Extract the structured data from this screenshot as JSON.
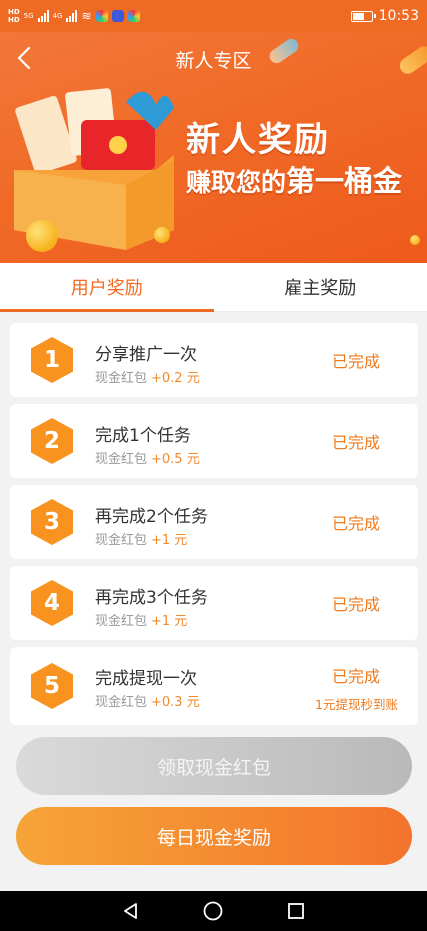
{
  "status_bar": {
    "network_top": "HD",
    "network_bottom": "HD",
    "sig1": "5G",
    "sig2": "4G",
    "time": "10:53"
  },
  "header": {
    "title": "新人专区",
    "back_icon": "chevron-left-icon"
  },
  "banner": {
    "line1": "新人奖励",
    "line2_prefix": "赚取您的",
    "line2_emphasis": "第一桶金"
  },
  "tabs": [
    {
      "label": "用户奖励",
      "active": true
    },
    {
      "label": "雇主奖励",
      "active": false
    }
  ],
  "tasks": [
    {
      "number": "1",
      "title": "分享推广一次",
      "reward_label": "现金红包",
      "reward_amount": "+0.2 元",
      "status": "已完成",
      "note": ""
    },
    {
      "number": "2",
      "title": "完成1个任务",
      "reward_label": "现金红包",
      "reward_amount": "+0.5 元",
      "status": "已完成",
      "note": ""
    },
    {
      "number": "3",
      "title": "再完成2个任务",
      "reward_label": "现金红包",
      "reward_amount": "+1 元",
      "status": "已完成",
      "note": ""
    },
    {
      "number": "4",
      "title": "再完成3个任务",
      "reward_label": "现金红包",
      "reward_amount": "+1 元",
      "status": "已完成",
      "note": ""
    },
    {
      "number": "5",
      "title": "完成提现一次",
      "reward_label": "现金红包",
      "reward_amount": "+0.3 元",
      "status": "已完成",
      "note": "1元提现秒到账"
    }
  ],
  "buttons": {
    "claim": "领取现金红包",
    "daily": "每日现金奖励"
  },
  "colors": {
    "accent": "#ef6b23",
    "banner": "#f06a26",
    "hex": "#f7931e"
  }
}
